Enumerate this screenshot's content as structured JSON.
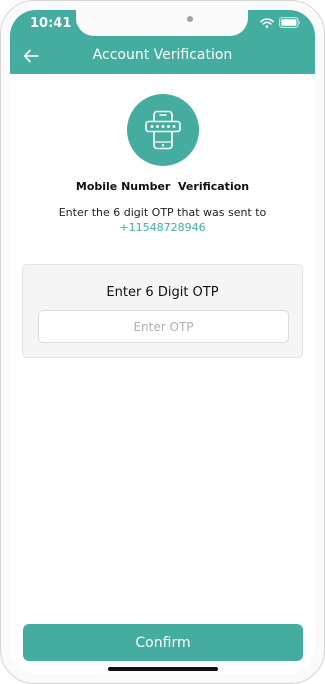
{
  "status_bar": {
    "time": "10:41"
  },
  "header": {
    "title": "Account Verification",
    "back_icon": "arrow-left-icon"
  },
  "verification": {
    "icon": "phone-password-icon",
    "title": "Mobile Number  Verification",
    "instruction": "Enter the 6 digit OTP that was sent to",
    "phone_number": "+11548728946"
  },
  "otp_card": {
    "label": "Enter 6 Digit OTP",
    "input_value": "",
    "input_placeholder": "Enter OTP"
  },
  "footer": {
    "confirm_label": "Confirm"
  },
  "colors": {
    "accent": "#45aca0",
    "card_background": "#f5f5f5",
    "text": "#111111"
  }
}
